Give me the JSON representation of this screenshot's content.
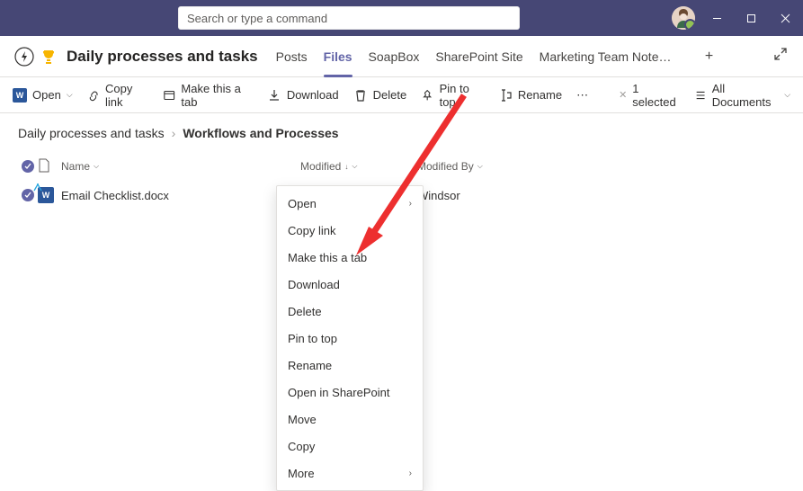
{
  "search": {
    "placeholder": "Search or type a command"
  },
  "window": {
    "min": "—",
    "max": "▢",
    "close": "✕"
  },
  "channel": {
    "title": "Daily processes and tasks"
  },
  "tabs": {
    "items": [
      "Posts",
      "Files",
      "SoapBox",
      "SharePoint Site",
      "Marketing Team Note…"
    ],
    "active_index": 1
  },
  "toolbar": {
    "open": "Open",
    "copylink": "Copy link",
    "maketab": "Make this a tab",
    "download": "Download",
    "delete": "Delete",
    "pintotop": "Pin to top",
    "rename": "Rename",
    "more": "⋯",
    "selected": "1 selected",
    "selected_x": "✕",
    "alldocs": "All Documents"
  },
  "breadcrumb": {
    "root": "Daily processes and tasks",
    "sep": "›",
    "current": "Workflows and Processes"
  },
  "columns": {
    "name": "Name",
    "modified": "Modified",
    "modifiedby": "Modified By",
    "sort": "↓",
    "chev": "⌵"
  },
  "files": {
    "row0": {
      "name": "Email Checklist.docx",
      "modifiedby": "Windsor",
      "more": "⋯"
    }
  },
  "contextmenu": {
    "open": "Open",
    "copylink": "Copy link",
    "maketab": "Make this a tab",
    "download": "Download",
    "delete": "Delete",
    "pintotop": "Pin to top",
    "rename": "Rename",
    "opensp": "Open in SharePoint",
    "move": "Move",
    "copy": "Copy",
    "more": "More",
    "chev": "›"
  }
}
